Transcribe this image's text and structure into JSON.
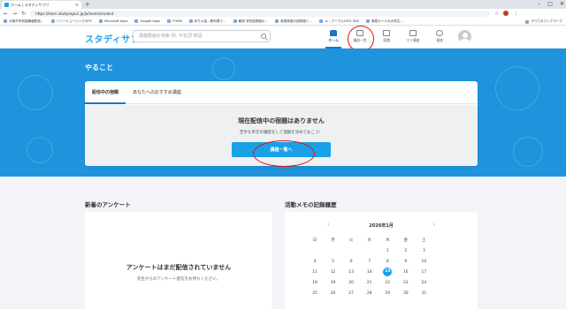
{
  "browser": {
    "tab_title": "ホーム | スタディサプリ",
    "tab_close": "×",
    "new_tab": "+",
    "window_controls": [
      "–",
      "□",
      "✕"
    ],
    "url": "https://learn.studysapuri.jp/ja/home/student",
    "bookmarks": [
      "大阪市学校園情報配信…",
      "ソニーミュージックのPC",
      "Microsoft Apps",
      "Google Apps",
      "FORM",
      "めちゃ話…教科書で…",
      "朝読 学校図書館の…",
      "英語単語の図書館と…",
      "ル・プーブル2025 SNS",
      "単語カードの大学生…"
    ],
    "bookmarks_right": "すべてのブックマーク"
  },
  "header": {
    "logo": "スタディサプリ",
    "search_placeholder": "講義動画を検索 例: 不定詞 物語",
    "nav": [
      {
        "label": "ホーム"
      },
      {
        "label": "講座一覧"
      },
      {
        "label": "宿題"
      },
      {
        "label": "マイ講座"
      },
      {
        "label": "連絡"
      }
    ]
  },
  "hero": {
    "title": "やること"
  },
  "todo_card": {
    "tabs": [
      "配信中の宿題",
      "あなたへのおすすめ講座"
    ],
    "empty_title": "現在配信中の宿題はありません",
    "empty_subtitle": "苦手な単元の講座をして理解を深めておこう！",
    "button_label": "講座一覧へ"
  },
  "survey": {
    "title": "新着のアンケート",
    "empty_title": "アンケートはまだ配信されていません",
    "empty_subtitle": "先生からのアンケート配信をお待ちください。"
  },
  "calendar": {
    "title": "活動メモの記録履歴",
    "month": "2026年1月",
    "prev": "‹",
    "next": "›",
    "weekdays": [
      "日",
      "月",
      "火",
      "水",
      "木",
      "金",
      "土"
    ],
    "weeks": [
      [
        "",
        "",
        "",
        "",
        "1",
        "2",
        "3"
      ],
      [
        "4",
        "5",
        "6",
        "7",
        "8",
        "9",
        "10"
      ],
      [
        "11",
        "12",
        "13",
        "14",
        "15",
        "16",
        "17"
      ],
      [
        "18",
        "19",
        "20",
        "21",
        "22",
        "23",
        "24"
      ],
      [
        "25",
        "26",
        "27",
        "28",
        "29",
        "30",
        "31"
      ]
    ],
    "today": "15"
  },
  "colors": {
    "accent": "#1aa0e6",
    "hero_bg": "#1f94dd",
    "annotation": "#e0101a"
  }
}
